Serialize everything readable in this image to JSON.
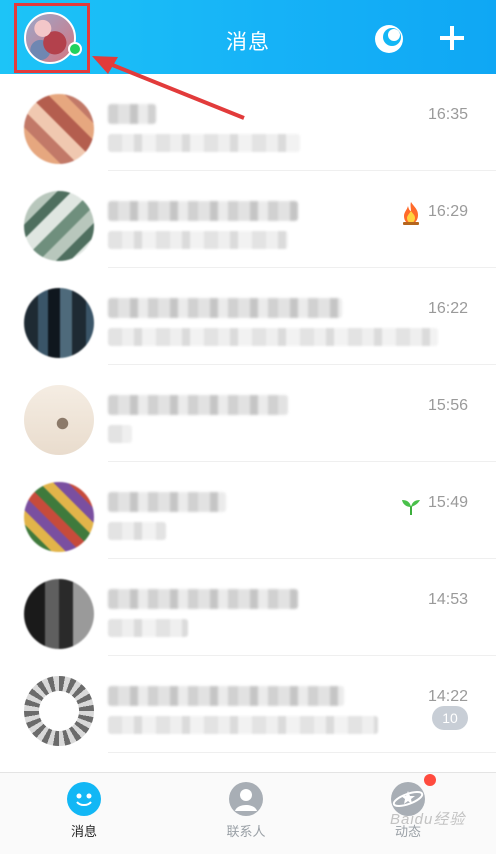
{
  "header": {
    "title": "消息",
    "accent": "#12b7f5",
    "annotation_color": "#e23b3b",
    "icons": [
      "avatar",
      "moon-icon",
      "plus-icon"
    ]
  },
  "conversations": [
    {
      "time": "16:35",
      "icon": null
    },
    {
      "time": "16:29",
      "icon": "fire-icon"
    },
    {
      "time": "16:22",
      "icon": null
    },
    {
      "time": "15:56",
      "icon": null
    },
    {
      "time": "15:49",
      "icon": "sprout-icon"
    },
    {
      "time": "14:53",
      "icon": null
    },
    {
      "time": "14:22",
      "icon": null,
      "unread": "10"
    },
    {
      "time": "",
      "icon": null
    }
  ],
  "tabs": [
    {
      "label": "消息",
      "icon": "message-icon",
      "active": true
    },
    {
      "label": "联系人",
      "icon": "contacts-icon",
      "active": false
    },
    {
      "label": "动态",
      "icon": "planet-icon",
      "active": false,
      "dot": true
    }
  ],
  "watermark": "Baidu经验"
}
